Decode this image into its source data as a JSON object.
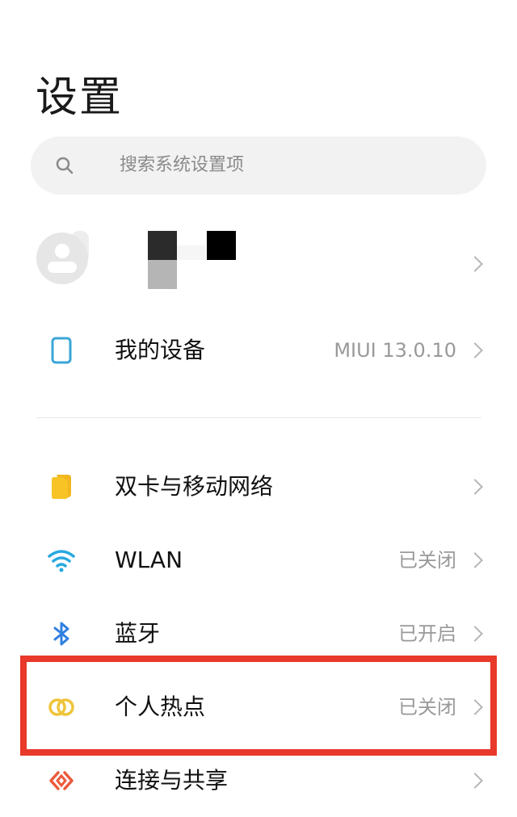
{
  "header": {
    "title": "设置"
  },
  "search": {
    "placeholder": "搜索系统设置项",
    "icon": "search-icon"
  },
  "account": {
    "icon": "avatar-icon"
  },
  "device": {
    "label": "我的设备",
    "value": "MIUI 13.0.10",
    "icon": "phone-icon"
  },
  "items": [
    {
      "label": "双卡与移动网络",
      "value": "",
      "icon": "sim-card-icon",
      "color": "#f7c325"
    },
    {
      "label": "WLAN",
      "value": "已关闭",
      "icon": "wifi-icon",
      "color": "#27a8e0"
    },
    {
      "label": "蓝牙",
      "value": "已开启",
      "icon": "bluetooth-icon",
      "color": "#2f7fe0"
    },
    {
      "label": "个人热点",
      "value": "已关闭",
      "icon": "hotspot-icon",
      "color": "#efc43a"
    },
    {
      "label": "连接与共享",
      "value": "",
      "icon": "connection-share-icon",
      "color": "#ec5a3c"
    }
  ],
  "colors": {
    "highlight": "#e8392a",
    "device_icon": "#3aa6d6"
  }
}
